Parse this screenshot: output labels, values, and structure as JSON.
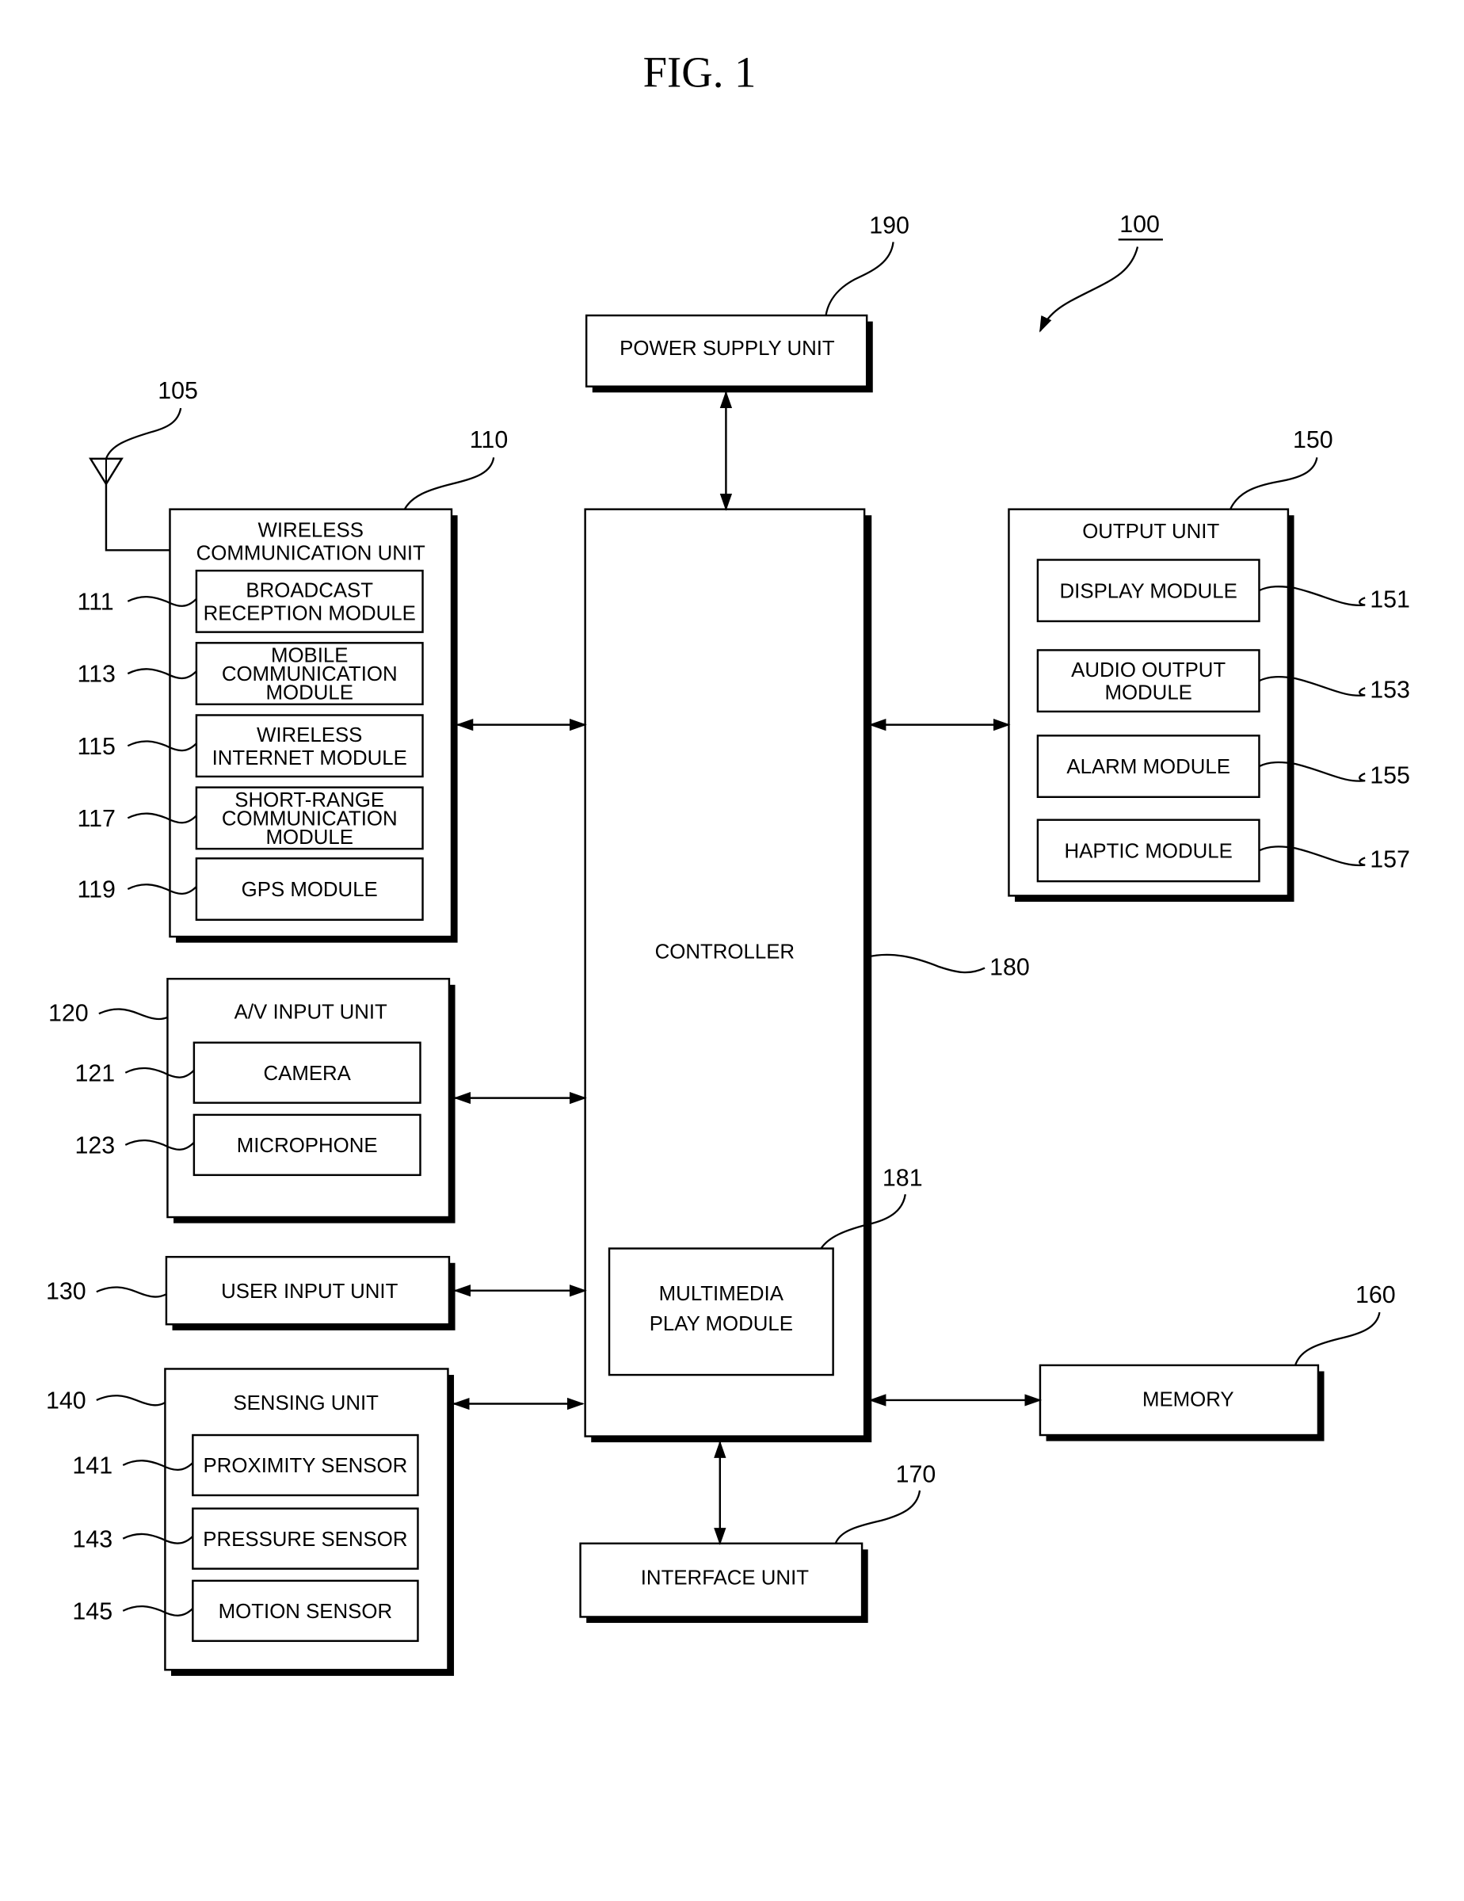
{
  "figure": {
    "title": "FIG. 1",
    "device_ref": "100"
  },
  "power_supply": {
    "label": "POWER SUPPLY UNIT",
    "ref": "190"
  },
  "antenna": {
    "ref": "105"
  },
  "wireless": {
    "label_lines": [
      "WIRELESS",
      "COMMUNICATION UNIT"
    ],
    "ref": "110",
    "modules": [
      {
        "ref": "111",
        "lines": [
          "BROADCAST",
          "RECEPTION MODULE"
        ]
      },
      {
        "ref": "113",
        "lines": [
          "MOBILE",
          "COMMUNICATION",
          "MODULE"
        ]
      },
      {
        "ref": "115",
        "lines": [
          "WIRELESS",
          "INTERNET MODULE"
        ]
      },
      {
        "ref": "117",
        "lines": [
          "SHORT-RANGE",
          "COMMUNICATION",
          "MODULE"
        ]
      },
      {
        "ref": "119",
        "lines": [
          "GPS MODULE"
        ]
      }
    ]
  },
  "av_input": {
    "label": "A/V INPUT UNIT",
    "ref": "120",
    "modules": [
      {
        "ref": "121",
        "label": "CAMERA"
      },
      {
        "ref": "123",
        "label": "MICROPHONE"
      }
    ]
  },
  "user_input": {
    "label": "USER INPUT UNIT",
    "ref": "130"
  },
  "sensing": {
    "label": "SENSING UNIT",
    "ref": "140",
    "modules": [
      {
        "ref": "141",
        "label": "PROXIMITY SENSOR"
      },
      {
        "ref": "143",
        "label": "PRESSURE SENSOR"
      },
      {
        "ref": "145",
        "label": "MOTION SENSOR"
      }
    ]
  },
  "output": {
    "label": "OUTPUT UNIT",
    "ref": "150",
    "modules": [
      {
        "ref": "151",
        "lines": [
          "DISPLAY MODULE"
        ]
      },
      {
        "ref": "153",
        "lines": [
          "AUDIO OUTPUT",
          "MODULE"
        ]
      },
      {
        "ref": "155",
        "lines": [
          "ALARM MODULE"
        ]
      },
      {
        "ref": "157",
        "lines": [
          "HAPTIC MODULE"
        ]
      }
    ]
  },
  "memory": {
    "label": "MEMORY",
    "ref": "160"
  },
  "interface": {
    "label": "INTERFACE UNIT",
    "ref": "170"
  },
  "controller": {
    "label": "CONTROLLER",
    "ref": "180",
    "multimedia": {
      "lines": [
        "MULTIMEDIA",
        "PLAY MODULE"
      ],
      "ref": "181"
    }
  }
}
